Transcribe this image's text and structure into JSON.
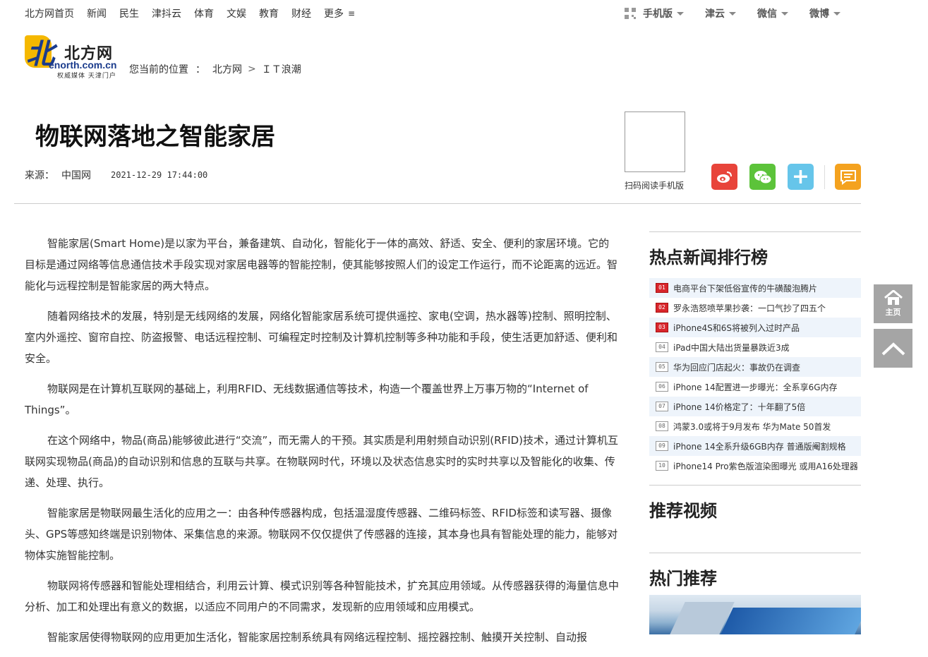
{
  "topnav": {
    "items": [
      "北方网首页",
      "新闻",
      "民生",
      "津抖云",
      "体育",
      "文娱",
      "教育",
      "财经"
    ],
    "more": "更多"
  },
  "topright": {
    "mobile": "手机版",
    "jinyun": "津云",
    "wechat": "微信",
    "weibo": "微博"
  },
  "logo": {
    "cn": "北方网",
    "en": "enorth.com.cn",
    "slogan": "权威媒体 天津门户"
  },
  "breadcrumb": {
    "label": "您当前的位置",
    "colon": "：",
    "home": "北方网",
    "section": "ＩＴ浪潮"
  },
  "article": {
    "title": "物联网落地之智能家居",
    "source_label": "来源：",
    "source": "中国网",
    "time": "2021-12-29 17:44:00",
    "qr_caption": "扫码阅读手机版",
    "paragraphs": [
      "智能家居(Smart Home)是以家为平台，兼备建筑、自动化，智能化于一体的高效、舒适、安全、便利的家居环境。它的目标是通过网络等信息通信技术手段实现对家居电器等的智能控制，使其能够按照人们的设定工作运行，而不论距离的远近。智能化与远程控制是智能家居的两大特点。",
      "随着网络技术的发展，特别是无线网络的发展，网络化智能家居系统可提供遥控、家电(空调，热水器等)控制、照明控制、室内外遥控、窗帘自控、防盗报警、电话远程控制、可编程定时控制及计算机控制等多种功能和手段，使生活更加舒适、便利和安全。",
      "物联网是在计算机互联网的基础上，利用RFID、无线数据通信等技术，构造一个覆盖世界上万事万物的“Internet of Things”。",
      "在这个网络中，物品(商品)能够彼此进行“交流”，而无需人的干预。其实质是利用射频自动识别(RFID)技术，通过计算机互联网实现物品(商品)的自动识别和信息的互联与共享。在物联网时代，环境以及状态信息实时的实时共享以及智能化的收集、传递、处理、执行。",
      "智能家居是物联网最生活化的应用之一：由各种传感器构成，包括温湿度传感器、二维码标签、RFID标签和读写器、摄像头、GPS等感知终端是识别物体、采集信息的来源。物联网不仅仅提供了传感器的连接，其本身也具有智能处理的能力，能够对物体实施智能控制。",
      "物联网将传感器和智能处理相结合，利用云计算、模式识别等各种智能技术，扩充其应用领域。从传感器获得的海量信息中分析、加工和处理出有意义的数据，以适应不同用户的不同需求，发现新的应用领域和应用模式。",
      "智能家居使得物联网的应用更加生活化，智能家居控制系统具有网络远程控制、摇控器控制、触摸开关控制、自动报"
    ]
  },
  "side": {
    "ranking_title": "热点新闻排行榜",
    "ranking": [
      {
        "num": "01",
        "text": "电商平台下架低俗宣传的牛磺酸泡腾片"
      },
      {
        "num": "02",
        "text": "罗永浩怒喷苹果抄袭：一口气抄了四五个"
      },
      {
        "num": "03",
        "text": "iPhone4S和6S将被列入过时产品"
      },
      {
        "num": "04",
        "text": "iPad中国大陆出货量暴跌近3成"
      },
      {
        "num": "05",
        "text": "华为回应门店起火：事故仍在调查"
      },
      {
        "num": "06",
        "text": "iPhone 14配置进一步曝光：全系享6G内存"
      },
      {
        "num": "07",
        "text": "iPhone 14价格定了：十年翻了5倍"
      },
      {
        "num": "08",
        "text": "鸿蒙3.0或将于9月发布 华为Mate 50首发"
      },
      {
        "num": "09",
        "text": "iPhone 14全系升级6GB内存 普通版阉割规格"
      },
      {
        "num": "10",
        "text": "iPhone14 Pro紫色版渲染图曝光 或用A16处理器"
      }
    ],
    "video_title": "推荐视频",
    "hot_title": "热门推荐"
  },
  "float": {
    "home_label": "主页"
  },
  "colors": {
    "hot_rank": "#d8262c",
    "weibo": "#e8443a",
    "wechat": "#5cc33a",
    "plus": "#66c5ea",
    "comment": "#f4a21f",
    "float_bg": "#a5a5a5"
  }
}
